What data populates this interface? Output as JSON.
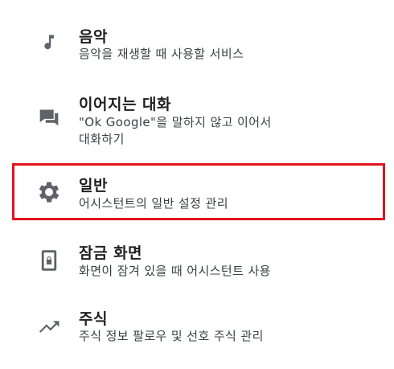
{
  "settings": {
    "items": [
      {
        "icon": "music-note-icon",
        "title": "음악",
        "subtitle_lines": [
          "음악을 재생할 때 사용할 서비스"
        ]
      },
      {
        "icon": "chat-bubble-icon",
        "title": "이어지는 대화",
        "subtitle_lines": [
          "\"Ok Google\"을 말하지 않고 이어서",
          "대화하기"
        ]
      },
      {
        "icon": "gear-icon",
        "title": "일반",
        "subtitle_lines": [
          "어시스턴트의 일반 설정 관리"
        ],
        "highlighted": true
      },
      {
        "icon": "lock-screen-icon",
        "title": "잠금 화면",
        "subtitle_lines": [
          "화면이 잠겨 있을 때 어시스턴트 사용"
        ]
      },
      {
        "icon": "trending-up-icon",
        "title": "주식",
        "subtitle_lines": [
          "주식 정보 팔로우 및 선호 주식 관리"
        ]
      }
    ],
    "highlight_color": "#e0141e",
    "icon_color": "#5f6368"
  }
}
